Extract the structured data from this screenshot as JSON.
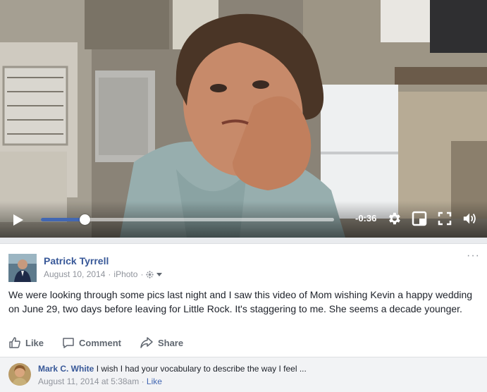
{
  "video": {
    "time_remaining": "-0:36",
    "progress_fraction": 0.15
  },
  "post": {
    "author": "Patrick Tyrrell",
    "date": "August 10, 2014",
    "app": "iPhoto",
    "separator": "·",
    "more": "···",
    "text": "We were looking through some pics last night and I saw this video of Mom wishing Kevin a happy wedding on June 29, two days before leaving for Little Rock. It's staggering to me. She seems a decade younger."
  },
  "actions": {
    "like": "Like",
    "comment": "Comment",
    "share": "Share"
  },
  "comment": {
    "author": "Mark C. White",
    "text": "I wish I had your vocabulary to describe the way I feel ...",
    "date": "August 11, 2014 at 5:38am",
    "separator": "·",
    "like": "Like"
  },
  "colors": {
    "link_blue": "#385898",
    "progress_blue": "#4267b2",
    "meta_gray": "#90949c"
  }
}
